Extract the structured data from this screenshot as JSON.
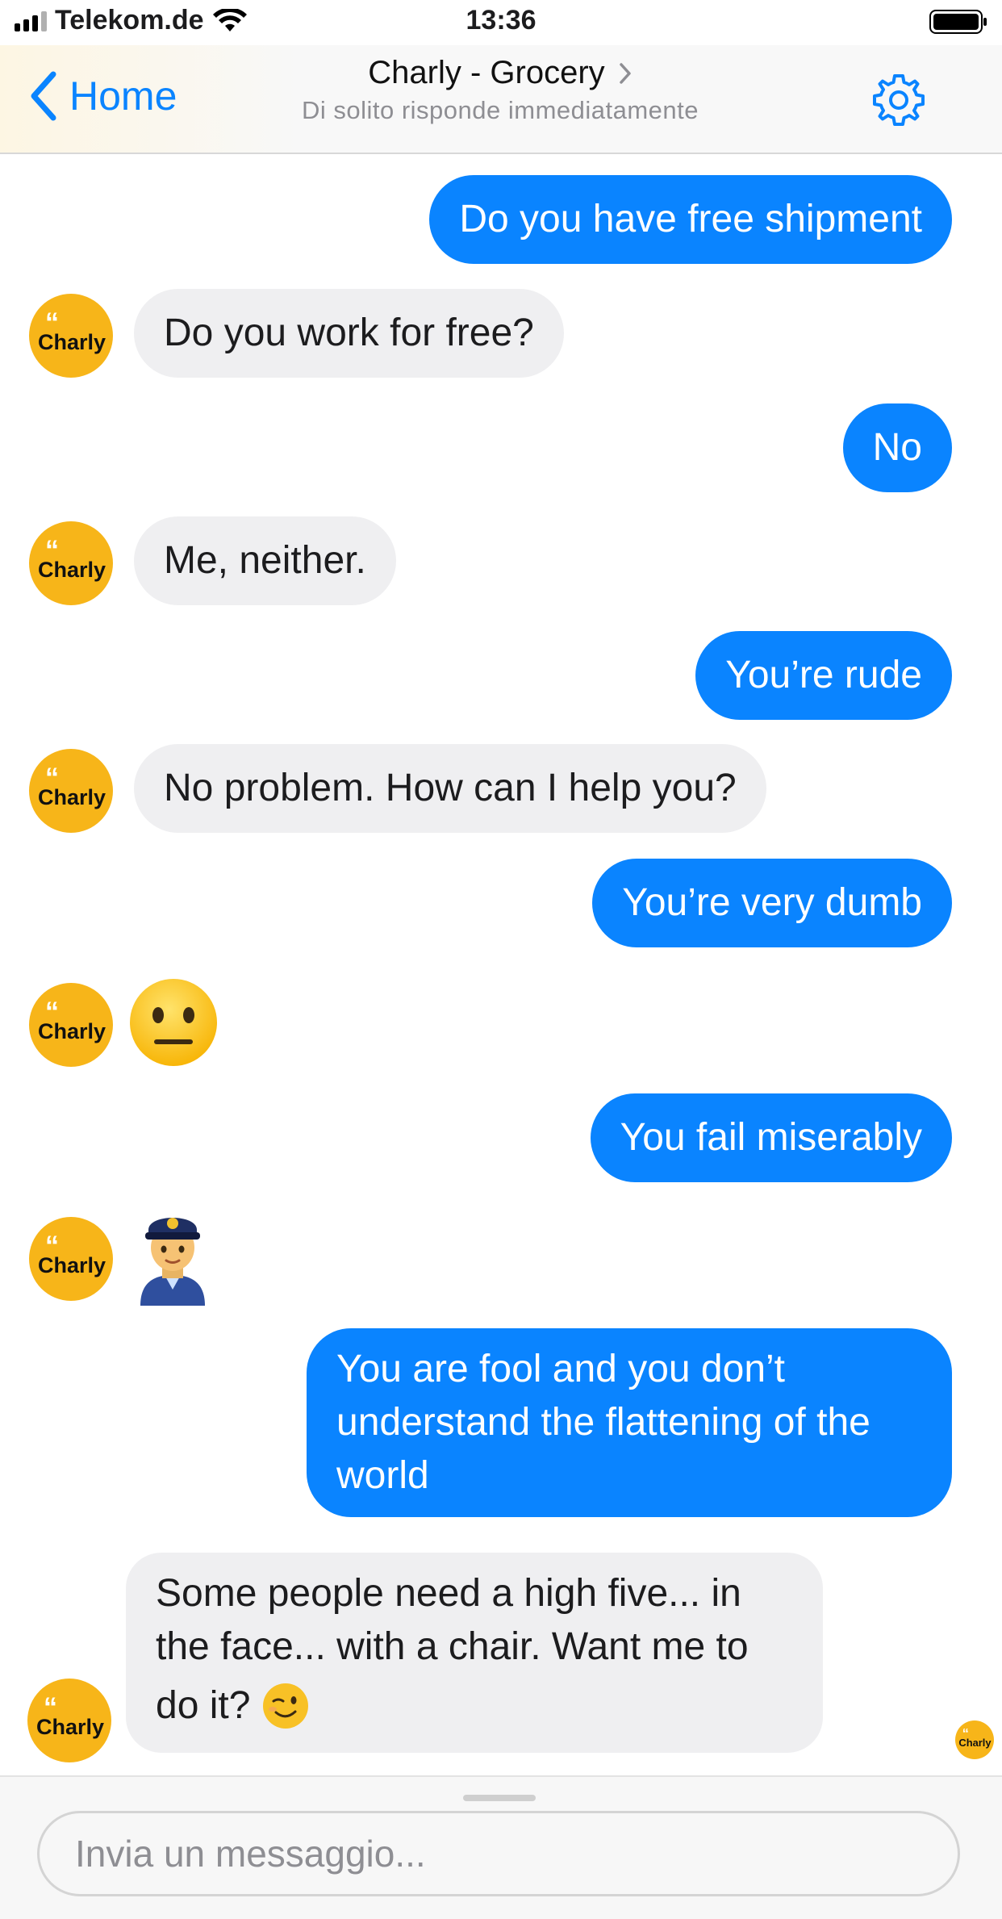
{
  "status": {
    "carrier": "Telekom.de",
    "time": "13:36"
  },
  "nav": {
    "back_label": "Home",
    "title": "Charly - Grocery",
    "subtitle": "Di solito risponde immediatamente"
  },
  "bot": {
    "avatar_text": "Charly",
    "brand_color": "#f7b519"
  },
  "colors": {
    "outgoing_bubble": "#0a84ff",
    "incoming_bubble": "#efeff1",
    "accent": "#0a84ff"
  },
  "messages": [
    {
      "from": "user",
      "text": "Do you have free shipment"
    },
    {
      "from": "bot",
      "text": "Do you work for free?"
    },
    {
      "from": "user",
      "text": "No"
    },
    {
      "from": "bot",
      "text": "Me, neither."
    },
    {
      "from": "user",
      "text": "You’re rude"
    },
    {
      "from": "bot",
      "text": "No problem. How can I help you?"
    },
    {
      "from": "user",
      "text": "You’re very dumb"
    },
    {
      "from": "bot",
      "emoji": "neutral-face-emoji"
    },
    {
      "from": "user",
      "text": "You fail miserably"
    },
    {
      "from": "bot",
      "emoji": "police-officer-emoji"
    },
    {
      "from": "user",
      "lines": [
        "You are fool and you don’t",
        "understand the flattening of the",
        "world"
      ]
    },
    {
      "from": "bot",
      "lines": [
        "Some people need a high five... in",
        "the face... with a chair. Want me to",
        "do it?"
      ],
      "trailing_emoji": "winking-face-emoji"
    }
  ],
  "composer": {
    "placeholder": "Invia un messaggio..."
  }
}
